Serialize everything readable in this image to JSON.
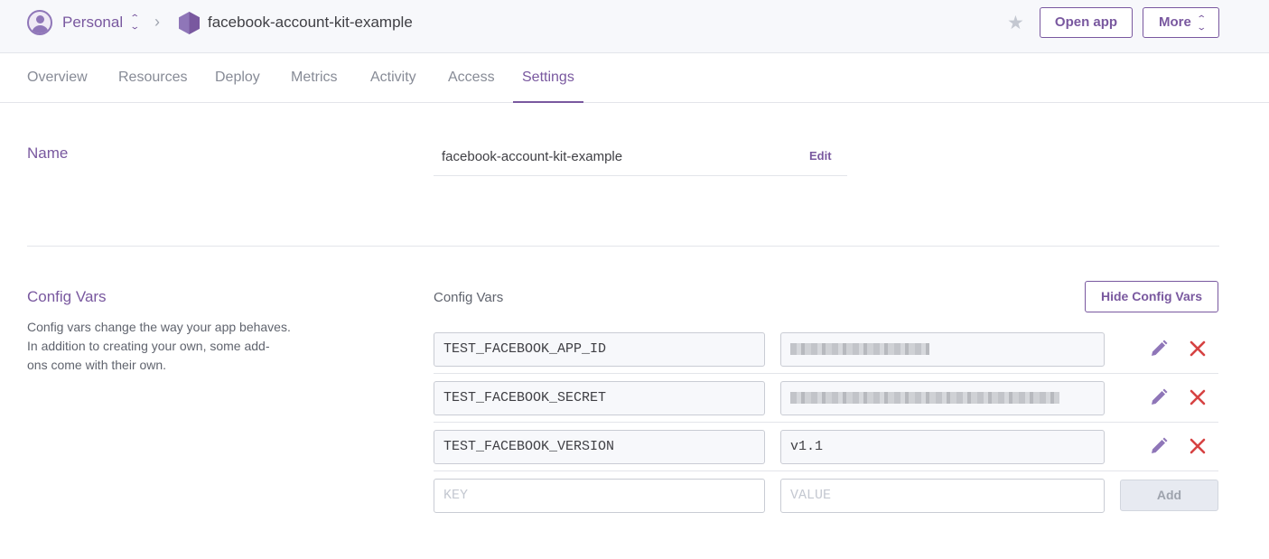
{
  "header": {
    "team": "Personal",
    "app_name": "facebook-account-kit-example",
    "open_app_label": "Open app",
    "more_label": "More",
    "icons": [
      "user-avatar-icon",
      "chevron-updown-icon",
      "chevron-right-icon",
      "app-hexagon-icon",
      "star-icon"
    ]
  },
  "tabs": [
    {
      "label": "Overview",
      "active": false
    },
    {
      "label": "Resources",
      "active": false
    },
    {
      "label": "Deploy",
      "active": false
    },
    {
      "label": "Metrics",
      "active": false
    },
    {
      "label": "Activity",
      "active": false
    },
    {
      "label": "Access",
      "active": false
    },
    {
      "label": "Settings",
      "active": true
    }
  ],
  "name_section": {
    "title": "Name",
    "value": "facebook-account-kit-example",
    "edit_label": "Edit"
  },
  "config_section": {
    "title": "Config Vars",
    "description": [
      "Config vars change the way your app behaves.",
      "In addition to creating your own, some add-",
      "ons come with their own."
    ],
    "list_label": "Config Vars",
    "hide_label": "Hide Config Vars",
    "vars": [
      {
        "key": "TEST_FACEBOOK_APP_ID",
        "value": "",
        "redacted": true
      },
      {
        "key": "TEST_FACEBOOK_SECRET",
        "value": "",
        "redacted": true
      },
      {
        "key": "TEST_FACEBOOK_VERSION",
        "value": "v1.1",
        "redacted": false
      }
    ],
    "new_var": {
      "key_placeholder": "KEY",
      "value_placeholder": "VALUE",
      "add_label": "Add"
    }
  },
  "colors": {
    "accent": "#79589f",
    "delete": "#d64242",
    "header_bg": "#f7f8fb",
    "border": "#e3e5ea"
  }
}
